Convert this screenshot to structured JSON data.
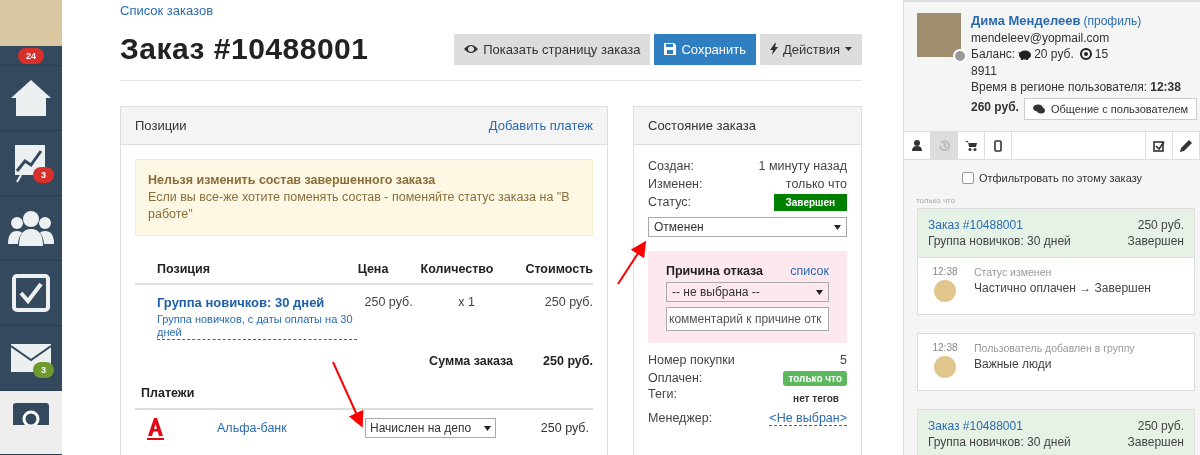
{
  "sidebar": {
    "badge": {
      "text": "24",
      "color": "#d9302c"
    },
    "items": [
      {
        "kind": "home",
        "selected": false
      },
      {
        "kind": "chart",
        "selected": false,
        "badge": {
          "text": "3",
          "color": "#d9302c"
        }
      },
      {
        "kind": "people",
        "selected": false
      },
      {
        "kind": "tasks",
        "selected": false
      },
      {
        "kind": "mail",
        "selected": false,
        "badge": {
          "text": "3",
          "color": "#6e9a30"
        }
      },
      {
        "kind": "settings",
        "selected": true
      }
    ]
  },
  "breadcrumb": "Список заказов",
  "title": "Заказ #10488001",
  "buttons": [
    {
      "kind": "eye",
      "label": "Показать страницу заказа"
    },
    {
      "kind": "save",
      "label": "Сохранить"
    },
    {
      "kind": "actions",
      "label": "Действия"
    }
  ],
  "positions": {
    "title": "Позиции",
    "action": "Добавить платеж",
    "alert": {
      "title": "Нельзя изменить состав завершенного заказа",
      "text": "Если вы все-же хотите поменять состав - поменяйте статус заказа на \"В работе\""
    },
    "columns": [
      "Позиция",
      "Цена",
      "Количество",
      "Стоимость"
    ],
    "rows": [
      {
        "name": "Группа новичков: 30 дней",
        "description": "Группа новичков, с даты оплаты на 30 дней",
        "price": "250 руб.",
        "quantity": "x 1",
        "cost": "250 руб."
      }
    ],
    "total_label": "Сумма заказа",
    "total_value": "250 руб.",
    "payments_title": "Платежи",
    "payments": [
      {
        "bank": "Альфа-банк",
        "status": "Начислен на депо",
        "amount": "250 руб."
      }
    ]
  },
  "state": {
    "title": "Состояние заказа",
    "fields": [
      {
        "kind": "text",
        "label": "Создан:",
        "value": "1 минуту назад"
      },
      {
        "kind": "text",
        "label": "Изменен:",
        "value": "только что"
      },
      {
        "kind": "badge",
        "label": "Статус:",
        "value": "Завершен",
        "color": "#008000"
      }
    ],
    "status_select": "Отменен",
    "reason": {
      "title": "Причина отказа",
      "link": "список",
      "select": "-- не выбрана --",
      "placeholder": "комментарий к причине отк"
    },
    "fields2": [
      {
        "kind": "text",
        "label": "Номер покупки",
        "value": "5"
      },
      {
        "kind": "badge",
        "label": "Оплачен:",
        "value": "только что",
        "color": "#5cb85c"
      },
      {
        "kind": "note",
        "label": "Теги:",
        "value": "нет тегов"
      },
      {
        "kind": "link",
        "label": "Менеджер:",
        "value": "<Не выбран>"
      }
    ]
  },
  "user": {
    "name": "Дима Менделеев",
    "profile": "(профиль)",
    "online": false,
    "email": "mendeleev@yopmail.com",
    "balance_label": "Баланс:",
    "balance": "20 руб.",
    "points": "15",
    "phone": "8911",
    "time_label": "Время в регионе пользователя:",
    "time": "12:38",
    "total": "260 руб.",
    "chat_button": "Общение с пользователем",
    "tabs": [
      {
        "kind": "person",
        "selected": false
      },
      {
        "kind": "history",
        "selected": true
      },
      {
        "kind": "cart",
        "selected": false
      },
      {
        "kind": "tablet",
        "selected": false
      },
      {
        "kind": "tasks",
        "selected": false
      },
      {
        "kind": "edit",
        "selected": false
      }
    ],
    "filter": {
      "label": "Отфильтровать по этому заказу",
      "checked": false
    },
    "feed_time": "только что",
    "feed": [
      {
        "kind": "order",
        "title": "Заказ #10488001",
        "amount": "250 руб.",
        "subtitle": "Группа новичков: 30 дней",
        "status": "Завершен"
      },
      {
        "kind": "event",
        "time": "12:38",
        "title": "Статус изменен",
        "text": "Частично оплачен → Завершен"
      },
      {
        "kind": "event",
        "time": "12:38",
        "title": "Пользователь добавлен в группу",
        "text": "Важные люди"
      },
      {
        "kind": "order",
        "title": "Заказ #10488001",
        "amount": "250 руб.",
        "subtitle": "Группа новичков: 30 дней",
        "status": "Завершен"
      }
    ]
  }
}
